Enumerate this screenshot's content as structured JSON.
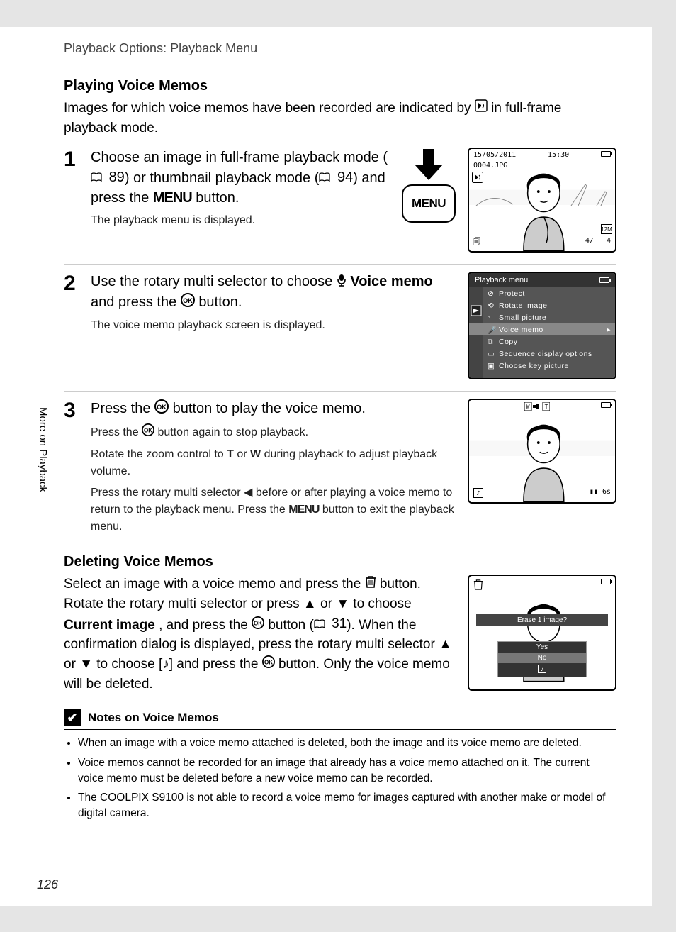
{
  "header": "Playback Options: Playback Menu",
  "sidebar": "More on Playback",
  "page_number": "126",
  "section1": {
    "title": "Playing Voice Memos",
    "intro_a": "Images for which voice memos have been recorded are indicated by ",
    "intro_b": " in full-frame playback mode."
  },
  "step1": {
    "num": "1",
    "main_a": "Choose an image in full-frame playback mode (",
    "ref1": "89",
    "main_b": ") or thumbnail playback mode (",
    "ref2": "94",
    "main_c": ") and press the ",
    "menu_word": "MENU",
    "main_d": " button.",
    "sub": "The playback menu is displayed.",
    "menu_label": "MENU",
    "lcd": {
      "date": "15/05/2011",
      "time": "15:30",
      "file": "0004.JPG",
      "counter_l": "4/",
      "counter_r": "4"
    }
  },
  "step2": {
    "num": "2",
    "main_a": "Use the rotary multi selector to choose ",
    "voice_memo": "Voice memo",
    "main_b": " and press the ",
    "main_c": " button.",
    "sub": "The voice memo playback screen is displayed.",
    "menu_title": "Playback menu",
    "items": {
      "protect": "Protect",
      "rotate": "Rotate image",
      "small": "Small picture",
      "voice": "Voice memo",
      "copy": "Copy",
      "seq": "Sequence display options",
      "key": "Choose key picture"
    }
  },
  "step3": {
    "num": "3",
    "main_a": "Press the ",
    "main_b": " button to play the voice memo.",
    "sub1_a": "Press the ",
    "sub1_b": " button again to stop playback.",
    "sub2_a": "Rotate the zoom control to ",
    "t": "T",
    "sub2_b": " or ",
    "w": "W",
    "sub2_c": " during playback to adjust playback volume.",
    "sub3_a": "Press the rotary multi selector ",
    "sub3_b": " before or after playing a voice memo to return to the playback menu. Press the ",
    "menu_word": "MENU",
    "sub3_c": " button to exit the playback menu.",
    "lcd_time": "6s"
  },
  "section2": {
    "title": "Deleting Voice Memos",
    "p_a": "Select an image with a voice memo and press the ",
    "p_b": " button. Rotate the rotary multi selector or press ",
    "p_c": " or ",
    "p_d": " to choose ",
    "current_image": "Current image",
    "p_e": ", and press the ",
    "p_f": " button (",
    "ref": "31",
    "p_g": "). When the confirmation dialog is displayed, press the rotary multi selector ",
    "p_h": " or ",
    "p_i": " to choose [",
    "p_j": "] and press the ",
    "p_k": " button. Only the voice memo will be deleted.",
    "lcd": {
      "prompt": "Erase 1 image?",
      "yes": "Yes",
      "no": "No"
    }
  },
  "notes": {
    "title": "Notes on Voice Memos",
    "n1": "When an image with a voice memo attached is deleted, both the image and its voice memo are deleted.",
    "n2": "Voice memos cannot be recorded for an image that already has a voice memo attached on it. The current voice memo must be deleted before a new voice memo can be recorded.",
    "n3": "The COOLPIX S9100 is not able to record a voice memo for images captured with another make or model of digital camera."
  }
}
